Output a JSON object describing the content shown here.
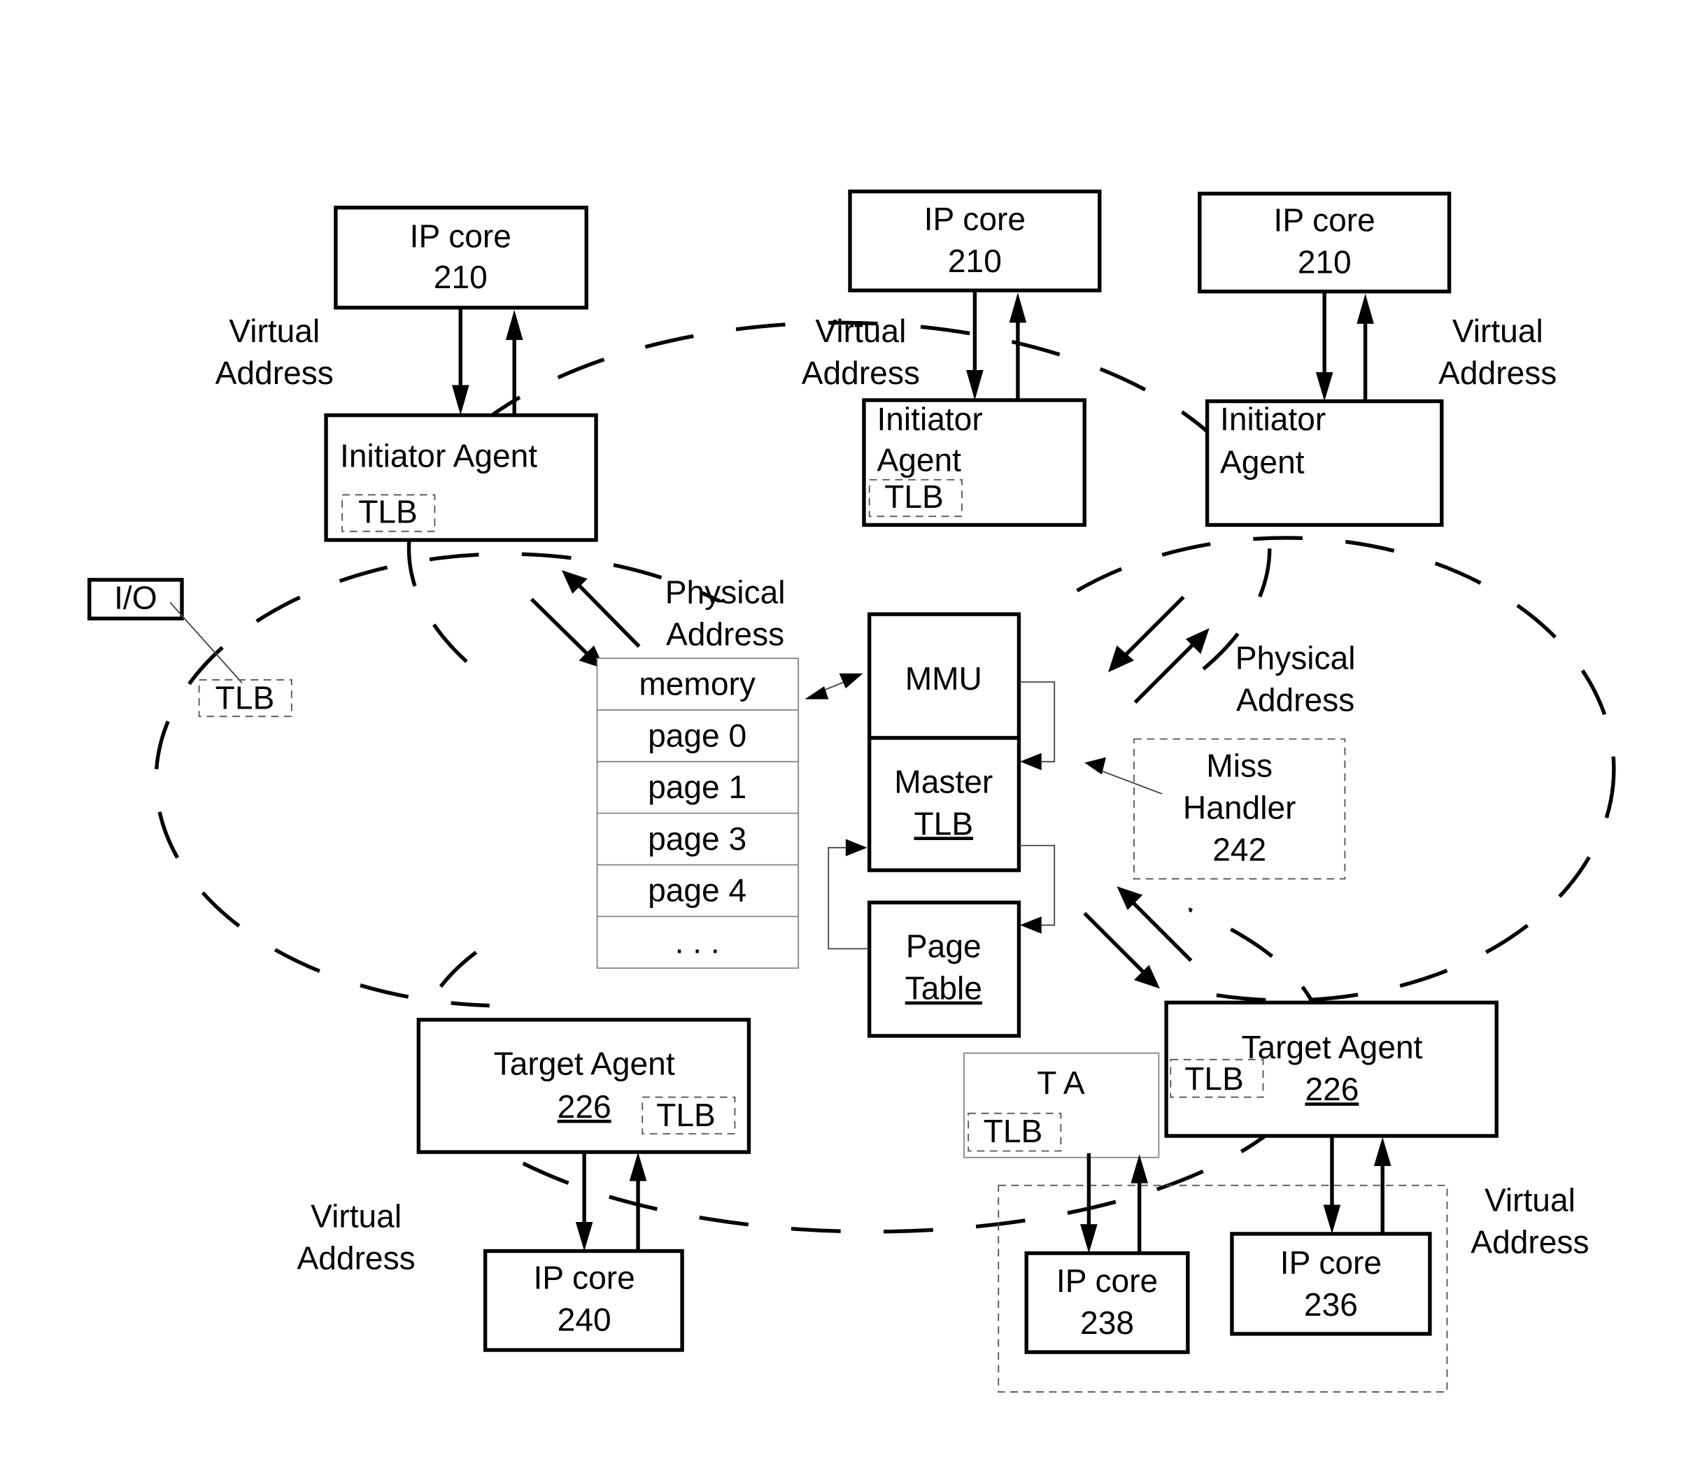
{
  "figure": {
    "initiator_groups": [
      {
        "ip_core": {
          "label": "IP core",
          "number": "210"
        },
        "agent": {
          "label_line1": "Initiator Agent",
          "label_line2": "",
          "tlb": "TLB"
        },
        "edge_label": {
          "line1": "Virtual",
          "line2": "Address"
        }
      },
      {
        "ip_core": {
          "label": "IP core",
          "number": "210"
        },
        "agent": {
          "label_line1": "Initiator",
          "label_line2": "Agent",
          "tlb": "TLB"
        },
        "edge_label": {
          "line1": "Virtual",
          "line2": "Address"
        }
      },
      {
        "ip_core": {
          "label": "IP core",
          "number": "210"
        },
        "agent": {
          "label_line1": "Initiator",
          "label_line2": "Agent",
          "tlb": ""
        },
        "edge_label": {
          "line1": "Virtual",
          "line2": "Address"
        }
      }
    ],
    "io": {
      "label": "I/O",
      "tlb": "TLB"
    },
    "physical_address_left": {
      "line1": "Physical",
      "line2": "Address"
    },
    "physical_address_right": {
      "line1": "Physical",
      "line2": "Address"
    },
    "memory": {
      "rows": [
        "memory",
        "page 0",
        "page 1",
        "page 3",
        "page 4",
        ". . ."
      ]
    },
    "mmu": {
      "label": "MMU"
    },
    "master_tlb": {
      "line1": "Master",
      "line2": "TLB"
    },
    "page_table": {
      "line1": "Page",
      "line2": "Table"
    },
    "miss_handler": {
      "line1": "Miss",
      "line2": "Handler",
      "number": "242"
    },
    "target_left": {
      "agent": {
        "label": "Target Agent",
        "number": "226",
        "tlb": "TLB"
      },
      "ip_core": {
        "label": "IP core",
        "number": "240"
      },
      "edge_label": {
        "line1": "Virtual",
        "line2": "Address"
      }
    },
    "target_small": {
      "label": "T A",
      "tlb": "TLB"
    },
    "target_right": {
      "agent": {
        "label": "Target Agent",
        "number": "226",
        "tlb": "TLB"
      },
      "ip_core_a": {
        "label": "IP core",
        "number": "238"
      },
      "ip_core_b": {
        "label": "IP core",
        "number": "236"
      },
      "edge_label": {
        "line1": "Virtual",
        "line2": "Address"
      }
    }
  }
}
